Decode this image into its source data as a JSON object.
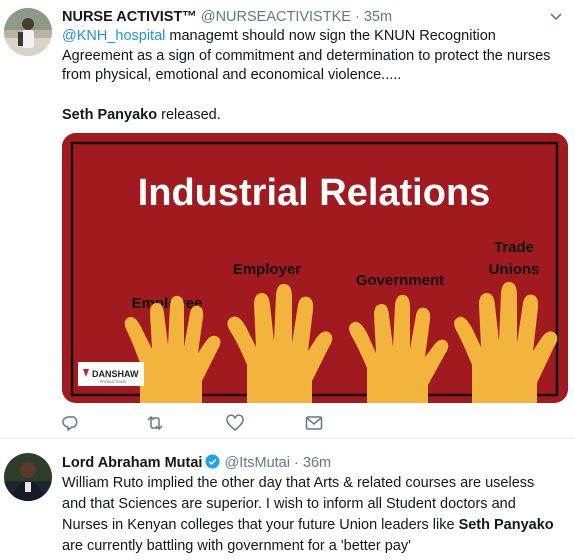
{
  "tweets": [
    {
      "name": "NURSE ACTIVIST™",
      "handle": "@NURSEACTIVISTKE",
      "time": "35m",
      "separator": "·",
      "text": {
        "mention": "@KNH_hospital",
        "part1": "  managemt should now sign the KNUN Recognition Agreement as a sign of commitment and determination to protect the nurses from physical, emotional and economical violence.....",
        "bold_name": "Seth Panyako",
        "part2": " released."
      },
      "media": {
        "title": "Industrial Relations",
        "labels": [
          "Employee",
          "Employer",
          "Government",
          "Trade",
          "Unions"
        ],
        "watermark": "DANSHAW",
        "watermark_sub": "PRODUCTIONS"
      },
      "actions": [
        "reply-icon",
        "retweet-icon",
        "like-icon",
        "message-icon"
      ]
    },
    {
      "name": "Lord Abraham Mutai",
      "handle": "@ItsMutai",
      "time": "36m",
      "separator": "·",
      "text": {
        "part1": "William Ruto implied the other day that Arts & related courses are useless and that Sciences are superior. I wish to inform all Student doctors and Nurses in Kenyan colleges that your future Union leaders like ",
        "bold_name": "Seth Panyako",
        "part2": " are currently battling with government for a 'better pay'"
      }
    }
  ],
  "colors": {
    "link": "#1b95e0",
    "meta": "#657786",
    "media_bg": "#a01a1f",
    "hand": "#f2b43c"
  }
}
